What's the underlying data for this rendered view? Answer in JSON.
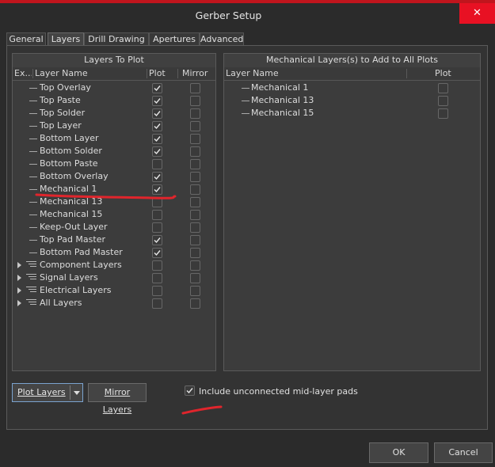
{
  "window": {
    "title": "Gerber Setup",
    "close_glyph": "✕"
  },
  "tabs": [
    {
      "label": "General",
      "active": false
    },
    {
      "label": "Layers",
      "active": true
    },
    {
      "label": "Drill Drawing",
      "active": false
    },
    {
      "label": "Apertures",
      "active": false
    },
    {
      "label": "Advanced",
      "active": false
    }
  ],
  "layers_panel": {
    "title": "Layers To Plot",
    "columns": {
      "expand": "Ex...",
      "name": "Layer Name",
      "plot": "Plot",
      "mirror": "Mirror"
    },
    "rows": [
      {
        "name": "Top Overlay",
        "plot": true,
        "mirror": false,
        "group": false
      },
      {
        "name": "Top Paste",
        "plot": true,
        "mirror": false,
        "group": false
      },
      {
        "name": "Top Solder",
        "plot": true,
        "mirror": false,
        "group": false
      },
      {
        "name": "Top Layer",
        "plot": true,
        "mirror": false,
        "group": false
      },
      {
        "name": "Bottom Layer",
        "plot": true,
        "mirror": false,
        "group": false
      },
      {
        "name": "Bottom Solder",
        "plot": true,
        "mirror": false,
        "group": false
      },
      {
        "name": "Bottom Paste",
        "plot": false,
        "mirror": false,
        "group": false
      },
      {
        "name": "Bottom Overlay",
        "plot": true,
        "mirror": false,
        "group": false
      },
      {
        "name": "Mechanical 1",
        "plot": true,
        "mirror": false,
        "group": false
      },
      {
        "name": "Mechanical 13",
        "plot": false,
        "mirror": false,
        "group": false
      },
      {
        "name": "Mechanical 15",
        "plot": false,
        "mirror": false,
        "group": false
      },
      {
        "name": "Keep-Out Layer",
        "plot": false,
        "mirror": false,
        "group": false
      },
      {
        "name": "Top Pad Master",
        "plot": true,
        "mirror": false,
        "group": false
      },
      {
        "name": "Bottom Pad Master",
        "plot": true,
        "mirror": false,
        "group": false
      },
      {
        "name": "Component Layers",
        "plot": false,
        "mirror": false,
        "group": true
      },
      {
        "name": "Signal Layers",
        "plot": false,
        "mirror": false,
        "group": true
      },
      {
        "name": "Electrical Layers",
        "plot": false,
        "mirror": false,
        "group": true
      },
      {
        "name": "All Layers",
        "plot": false,
        "mirror": false,
        "group": true
      }
    ]
  },
  "mech_panel": {
    "title": "Mechanical Layers(s) to Add to All Plots",
    "columns": {
      "name": "Layer Name",
      "plot": "Plot"
    },
    "rows": [
      {
        "name": "Mechanical 1",
        "plot": false
      },
      {
        "name": "Mechanical 13",
        "plot": false
      },
      {
        "name": "Mechanical 15",
        "plot": false
      }
    ]
  },
  "bottom": {
    "plot_layers_label": "Plot Layers",
    "mirror_layers_label": "Mirror Layers",
    "include_unconnected_label": "Include unconnected mid-layer pads",
    "include_unconnected_checked": true
  },
  "footer": {
    "ok_label": "OK",
    "cancel_label": "Cancel"
  },
  "colors": {
    "annotation": "#e0252c",
    "accent": "#7aa3cf",
    "titlebar_strip": "#c0151d"
  },
  "icons": [
    "close-icon",
    "checkmark-icon",
    "expand-arrow-icon",
    "layer-group-icon",
    "dropdown-arrow-icon"
  ]
}
